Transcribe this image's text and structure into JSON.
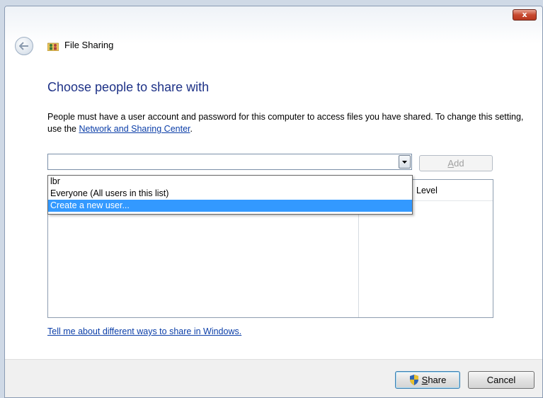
{
  "window": {
    "title": "File Sharing",
    "close_label": "x"
  },
  "main": {
    "heading": "Choose people to share with",
    "description_before": "People must have a user account and password for this computer to access files you have shared.  To change this setting, use the ",
    "description_link": "Network and Sharing Center",
    "description_after": "."
  },
  "combo": {
    "value": "",
    "options": [
      "lbr",
      "Everyone (All users in this list)",
      "Create a new user..."
    ],
    "highlighted_index": 2
  },
  "add_button": {
    "label_accel": "A",
    "label_rest": "dd",
    "enabled": false
  },
  "table": {
    "level_header": "Level"
  },
  "help_link": "Tell me about different ways to share in Windows.",
  "footer": {
    "share_accel": "S",
    "share_rest": "hare",
    "cancel_label": "Cancel"
  },
  "icons": {
    "back": "back-arrow-icon",
    "title": "users-folder-icon",
    "dropdown": "chevron-down-icon",
    "uac": "uac-shield-icon"
  }
}
